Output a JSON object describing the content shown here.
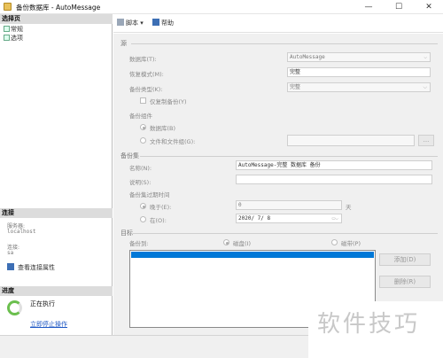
{
  "window": {
    "title": "备份数据库 - AutoMessage",
    "minimize": "—",
    "maximize": "☐",
    "close": "✕"
  },
  "left": {
    "select_page_header": "选择页",
    "pages": [
      "常规",
      "选项"
    ],
    "connection_header": "连接",
    "server_label": "服务器:",
    "server_value": "localhost",
    "connection_label": "连接:",
    "connection_value": "sa",
    "view_connection_properties": "查看连接属性",
    "progress_header": "进度",
    "progress_status": "正在执行",
    "stop_action": "立即停止操作"
  },
  "toolbar": {
    "script_label": "脚本",
    "script_arrow": "▾",
    "help_label": "帮助"
  },
  "source": {
    "group_label": "源",
    "database_label": "数据库(T):",
    "database_value": "AutoMessage",
    "recovery_model_label": "恢复模式(M):",
    "recovery_model_value": "完整",
    "backup_type_label": "备份类型(K):",
    "backup_type_value": "完整",
    "copy_only_label": "仅复制备份(Y)",
    "backup_component_label": "备份组件",
    "database_option": "数据库(B)",
    "files_option": "文件和文件组(G):",
    "browse_button": "..."
  },
  "backup_set": {
    "group_label": "备份集",
    "name_label": "名称(N):",
    "name_value": "AutoMessage-完整 数据库 备份",
    "description_label": "说明(S):",
    "description_value": "",
    "expire_label": "备份集过期时间",
    "after_label": "晚于(E):",
    "after_value": "0",
    "after_unit": "天",
    "on_label": "在(O):",
    "on_value": "2020/ 7/ 8"
  },
  "destination": {
    "group_label": "目标",
    "backup_to_label": "备份到:",
    "disk_option": "磁盘(I)",
    "tape_option": "磁带(P)",
    "add_button": "添加(D)",
    "remove_button": "删除(R)"
  },
  "watermark": "软件技巧",
  "colors": {
    "selection": "#0078d7",
    "link": "#1d57c4",
    "progress": "#6bbf4e"
  }
}
